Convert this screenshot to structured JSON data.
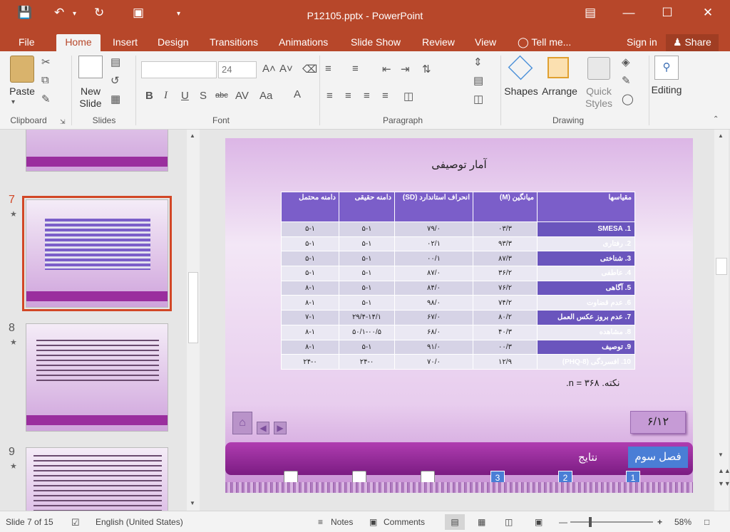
{
  "title_bar": {
    "title": "P12105.pptx - PowerPoint"
  },
  "tabs": {
    "file": "File",
    "home": "Home",
    "insert": "Insert",
    "design": "Design",
    "transitions": "Transitions",
    "animations": "Animations",
    "slideshow": "Slide Show",
    "review": "Review",
    "view": "View",
    "tellme": "Tell me...",
    "signin": "Sign in",
    "share": "Share"
  },
  "ribbon": {
    "paste": "Paste",
    "new_slide_1": "New",
    "new_slide_2": "Slide",
    "font_size": "24",
    "shapes": "Shapes",
    "arrange": "Arrange",
    "quick_1": "Quick",
    "quick_2": "Styles",
    "editing": "Editing",
    "groups": {
      "clipboard": "Clipboard",
      "slides": "Slides",
      "font": "Font",
      "paragraph": "Paragraph",
      "drawing": "Drawing"
    }
  },
  "thumbnails": {
    "n7": "7",
    "n8": "8",
    "n9": "9"
  },
  "slide": {
    "title": "آمار توصیفی",
    "headers": [
      "مقیاسها",
      "میانگین (M)",
      "انحراف استاندارد (SD)",
      "دامنه حقیقی",
      "دامنه محتمل"
    ],
    "rows": [
      [
        "1. SMESA",
        "۰۳/۳",
        "۷۹/۰",
        "۵-۱",
        "۵-۱"
      ],
      [
        "2. رفتاری",
        "۹۳/۳",
        "۰۲/۱",
        "۵-۱",
        "۵-۱"
      ],
      [
        "3. شناختی",
        "۸۷/۳",
        "۰۰/۱",
        "۵-۱",
        "۵-۱"
      ],
      [
        "4. عاطفی",
        "۳۶/۲",
        "۸۷/۰",
        "۵-۱",
        "۵-۱"
      ],
      [
        "5. آگاهی",
        "۷۶/۲",
        "۸۴/۰",
        "۵-۱",
        "۸-۱"
      ],
      [
        "6. عدم قضاوت",
        "۷۴/۲",
        "۹۸/۰",
        "۵-۱",
        "۸-۱"
      ],
      [
        "7. عدم بروز عکس العمل",
        "۸۰/۲",
        "۶۷/۰",
        "۲۹/۴-۱۴/۱",
        "۷-۱"
      ],
      [
        "8. مشاهده",
        "۴۰/۳",
        "۶۸/۰",
        "۵۰/۱-۰۰/۵",
        "۸-۱"
      ],
      [
        "9. توصیف",
        "۰۰/۳",
        "۹۱/۰",
        "۵-۱",
        "۸-۱"
      ],
      [
        "10. افسردگی (PHQ-8)",
        "۱۲/۹",
        "۷۰/۰",
        "۲۴-۰",
        "۲۴-۰"
      ]
    ],
    "note": "نکته. ۳۶۸ = n.",
    "page": "۶/۱۲",
    "chapter": "فصل سوم",
    "results": "نتایج",
    "nav_numbers": [
      "1",
      "2",
      "3"
    ]
  },
  "status": {
    "slide": "Slide 7 of 15",
    "language": "English (United States)",
    "notes": "Notes",
    "comments": "Comments",
    "zoom": "58%"
  }
}
